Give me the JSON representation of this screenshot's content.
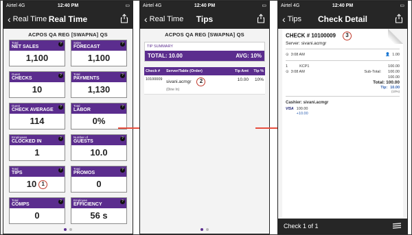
{
  "status": {
    "carrier": "Airtel",
    "network": "4G",
    "time": "12:40 PM"
  },
  "screen1": {
    "back": "Real Time",
    "title": "Real Time",
    "store": "ACPOS QA REG [SWAPNA] QS",
    "tiles": [
      {
        "small": "Total",
        "big": "NET SALES",
        "value": "1,100"
      },
      {
        "small": "Sales",
        "big": "FORECAST",
        "value": "1,100"
      },
      {
        "small": "Guest",
        "big": "CHECKS",
        "value": "10"
      },
      {
        "small": "Total",
        "big": "PAYMENTS",
        "value": "1,130"
      },
      {
        "small": "Guest",
        "big": "CHECK AVERAGE",
        "value": "114"
      },
      {
        "small": "Total",
        "big": "LABOR",
        "value": "0%"
      },
      {
        "small": "Employees",
        "big": "CLOCKED IN",
        "value": "1"
      },
      {
        "small": "Number of",
        "big": "GUESTS",
        "value": "10.0"
      },
      {
        "small": "Total",
        "big": "TIPS",
        "value": "10",
        "callout": "1"
      },
      {
        "small": "Total",
        "big": "PROMOS",
        "value": "0"
      },
      {
        "small": "Total",
        "big": "COMPS",
        "value": "0"
      },
      {
        "small": "Employee",
        "big": "EFFICIENCY",
        "value": "56 s"
      }
    ],
    "badge": "?"
  },
  "screen2": {
    "back": "Real Time",
    "title": "Tips",
    "store": "ACPOS QA REG [SWAPNA] QS",
    "summary_label": "TIP SUMMARY",
    "total": "TOTAL: 10.00",
    "avg": "AVG: 10%",
    "columns": [
      "Check #",
      "Server/Table (Order)",
      "Tip Amt",
      "Tip %"
    ],
    "row": {
      "check": "10100009",
      "server": "sivani.acmgr",
      "order": "(Dine In)",
      "tip_amt": "10.00",
      "tip_pct": "10%",
      "callout": "2"
    }
  },
  "screen3": {
    "back": "Tips",
    "title": "Check Detail",
    "check": "CHECK # 10100009",
    "server": "Server: sivani.acmgr",
    "callout": "3",
    "open_time": "3:08 AM",
    "guests": "1.00",
    "item_qty": "1",
    "item_name": "KCP1",
    "item_price": "100.00",
    "subtotal_label": "Sub-Total:",
    "subtotal": "100.00",
    "item_time": "3:08 AM",
    "item_time_amt": "100.00",
    "total": "Total: 100.00",
    "tip_label": "Tip:",
    "tip": "10.00",
    "tip_pct": "(10%)",
    "cashier": "Cashier: sivani.acmgr",
    "card": "VISA",
    "pay_amount": "100.00",
    "pay_tip": "+10.00",
    "footer": "Check 1 of 1"
  }
}
